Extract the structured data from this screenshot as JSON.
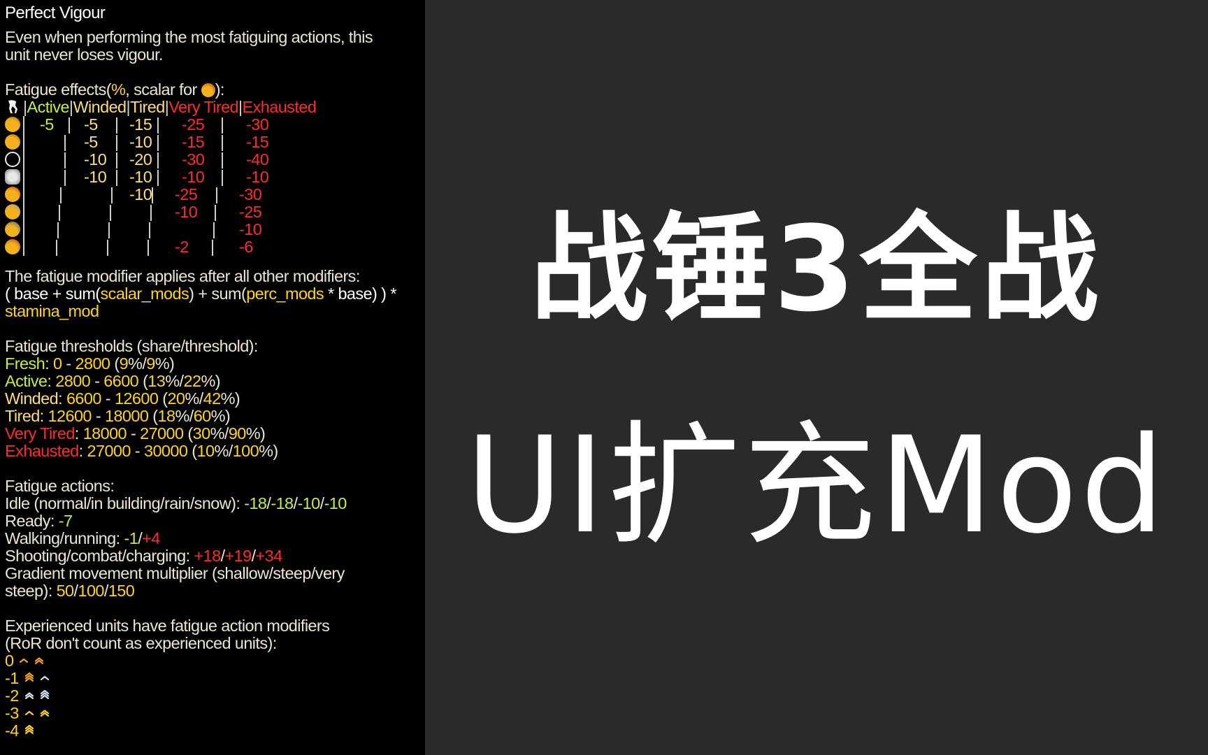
{
  "tooltip": {
    "title": "Perfect Vigour",
    "description_line1": "Even when performing the most fatiguing actions, this",
    "description_line2": "unit never loses vigour.",
    "effects_heading": {
      "prefix": "Fatigue effects(",
      "percent": "%",
      "middle": ", scalar for ",
      "suffix": "):",
      "scalar_icon": "stamina-icon"
    },
    "table": {
      "header_icon": "fatigue-leg-icon",
      "columns": [
        {
          "label": "Active",
          "color": "#c6ee3a"
        },
        {
          "label": "Winded",
          "color": "#ffdd78"
        },
        {
          "label": "Tired",
          "color": "#ffdd78"
        },
        {
          "label": "Very Tired",
          "color": "#ff2b2b"
        },
        {
          "label": "Exhausted",
          "color": "#ff2b2b"
        }
      ],
      "rows": [
        {
          "icon": "melee-attack-icon",
          "values": [
            "-5",
            "-5",
            "-15",
            "-25",
            "-30"
          ]
        },
        {
          "icon": "speed-icon",
          "values": [
            "",
            "-5",
            "-10",
            "-15",
            "-15"
          ]
        },
        {
          "icon": "reload-icon",
          "values": [
            "",
            "-10",
            "-20",
            "-30",
            "-40"
          ]
        },
        {
          "icon": "charge-bonus-icon",
          "values": [
            "",
            "-10",
            "-10",
            "-10",
            "-10"
          ]
        },
        {
          "icon": "weapon-strength-icon",
          "values": [
            "",
            "",
            "-10",
            "-25",
            "-30"
          ]
        },
        {
          "icon": "armour-icon",
          "values": [
            "",
            "",
            "",
            "-10",
            "-25"
          ]
        },
        {
          "icon": "melee-defence-icon",
          "values": [
            "",
            "",
            "",
            "",
            "-10"
          ]
        },
        {
          "icon": "stamina-icon",
          "values": [
            "",
            "",
            "",
            "-2",
            "-6"
          ]
        }
      ]
    },
    "formula": {
      "line1": "The fatigue modifier applies after all other modifiers:",
      "open": "( base + sum(",
      "scalar": "scalar_mods",
      "mid": ") + sum(",
      "perc": "perc_mods",
      "end": " * base) ) *",
      "stamina": "stamina_mod"
    },
    "thresholds": {
      "heading": "Fatigue thresholds (share/threshold):",
      "items": [
        {
          "name": "Fresh",
          "name_color": "#c6ee3a",
          "from": "0",
          "to": "2800",
          "share": "9",
          "threshold": "9"
        },
        {
          "name": "Active",
          "name_color": "#c6ee3a",
          "from": "2800",
          "to": "6600",
          "share": "13",
          "threshold": "22"
        },
        {
          "name": "Winded",
          "name_color": "#ffdd78",
          "from": "6600",
          "to": "12600",
          "share": "20",
          "threshold": "42"
        },
        {
          "name": "Tired",
          "name_color": "#ffdd78",
          "from": "12600",
          "to": "18000",
          "share": "18",
          "threshold": "60"
        },
        {
          "name": "Very Tired",
          "name_color": "#ff2b2b",
          "from": "18000",
          "to": "27000",
          "share": "30",
          "threshold": "90"
        },
        {
          "name": "Exhausted",
          "name_color": "#ff2b2b",
          "from": "27000",
          "to": "30000",
          "share": "10",
          "threshold": "100"
        }
      ]
    },
    "actions": {
      "heading": "Fatigue actions:",
      "idle_label": "Idle (normal/in building/rain/snow): ",
      "idle_values": [
        "-18",
        "-18",
        "-10",
        "-10"
      ],
      "ready_label": "Ready: ",
      "ready_value": "-7",
      "walk_label": "Walking/running: ",
      "walk_value": "-1",
      "run_value": "+4",
      "combat_label": "Shooting/combat/charging: ",
      "combat_values": [
        "+18",
        "+19",
        "+34"
      ],
      "gradient_label_1": "Gradient movement multiplier (shallow/steep/very",
      "gradient_label_2": "steep): ",
      "gradient_values": [
        "50",
        "100",
        "150"
      ]
    },
    "experience": {
      "line1": "Experienced units have fatigue action modifiers",
      "line2": "(RoR don't count as experienced units):",
      "levels": [
        {
          "value": "0",
          "ranks": [
            "rank-1-bronze",
            "rank-2-bronze"
          ]
        },
        {
          "value": "-1",
          "ranks": [
            "rank-3-bronze",
            "rank-1-silver"
          ]
        },
        {
          "value": "-2",
          "ranks": [
            "rank-2-silver",
            "rank-3-silver"
          ]
        },
        {
          "value": "-3",
          "ranks": [
            "rank-1-gold",
            "rank-2-gold"
          ]
        },
        {
          "value": "-4",
          "ranks": [
            "rank-3-gold"
          ]
        }
      ]
    }
  },
  "hero": {
    "line1": "战锤3全战",
    "line2": "UI扩充Mod"
  },
  "colors": {
    "panel_bg": "#000000",
    "page_bg": "#2a2a2a",
    "green": "#c6ee3a",
    "yellow": "#ffd41c",
    "pale_yellow": "#ffdd78",
    "red": "#ff2b2b",
    "text": "#ece5d4"
  }
}
